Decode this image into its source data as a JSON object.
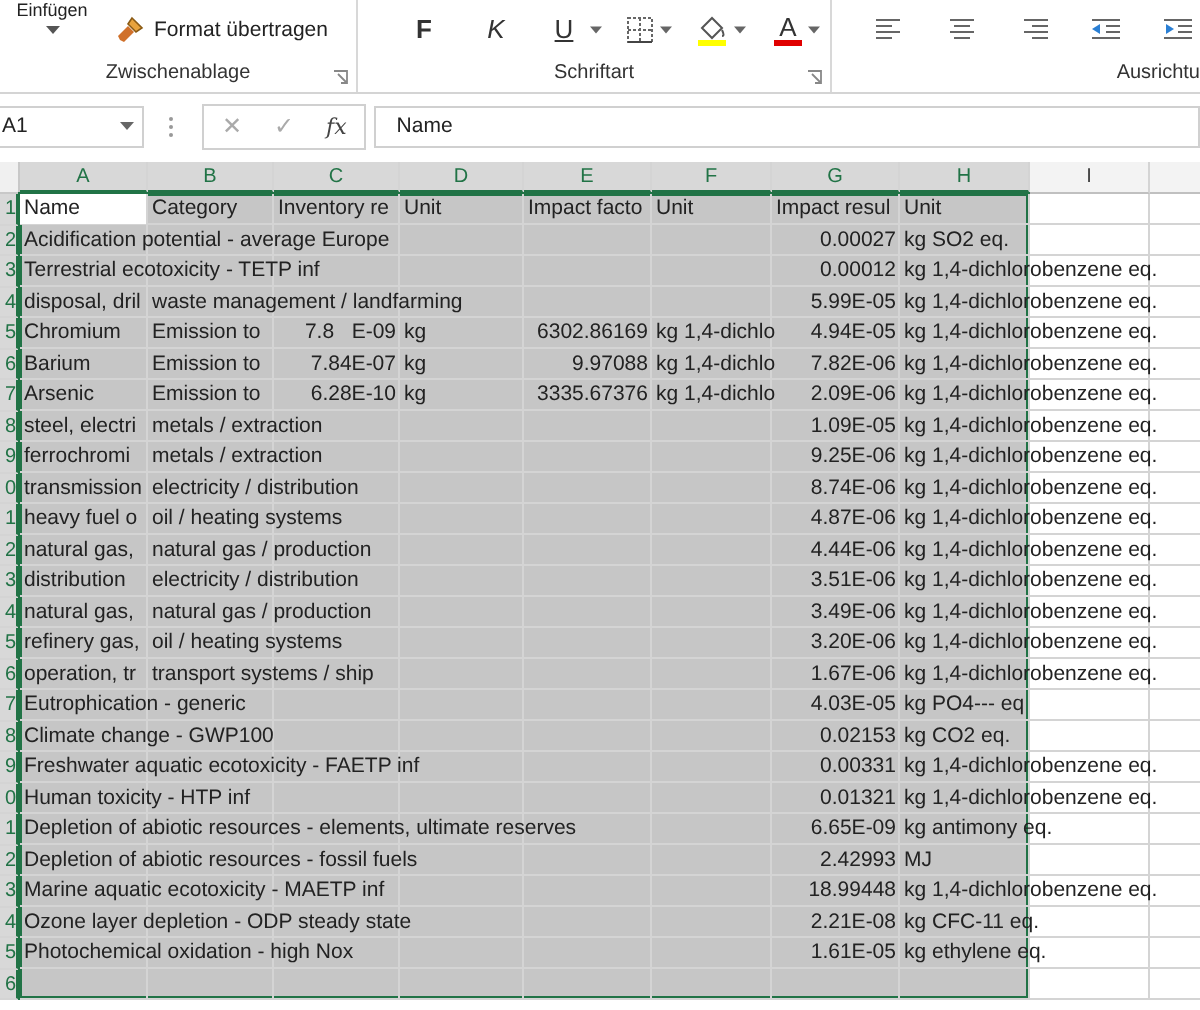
{
  "ribbon": {
    "paste_label": "Einfügen",
    "format_painter": "Format übertragen",
    "bold": "F",
    "italic": "K",
    "underline": "U",
    "font_color": "A",
    "groups": [
      {
        "label": "Zwischenablage",
        "launcher": true
      },
      {
        "label": "Schriftart",
        "launcher": true
      },
      {
        "label": "Ausrichtu",
        "launcher": false
      }
    ]
  },
  "formula_bar": {
    "name_box": "A1",
    "cancel": "✕",
    "enter": "✓",
    "function_label": "fx",
    "value": "Name"
  },
  "columns": [
    {
      "label": "A",
      "selected": true
    },
    {
      "label": "B",
      "selected": true
    },
    {
      "label": "C",
      "selected": true
    },
    {
      "label": "D",
      "selected": true
    },
    {
      "label": "E",
      "selected": true
    },
    {
      "label": "F",
      "selected": true
    },
    {
      "label": "G",
      "selected": true
    },
    {
      "label": "H",
      "selected": true
    },
    {
      "label": "I",
      "selected": false
    }
  ],
  "rows": [
    {
      "number": "1",
      "selected": true,
      "cells": [
        {
          "kind": "text",
          "text": "Name",
          "active": true
        },
        {
          "kind": "text",
          "text": "Category"
        },
        {
          "kind": "text",
          "text": "Inventory re"
        },
        {
          "kind": "text",
          "text": "Unit"
        },
        {
          "kind": "text",
          "text": "Impact facto"
        },
        {
          "kind": "text",
          "text": "Unit"
        },
        {
          "kind": "text",
          "text": "Impact resul"
        },
        {
          "kind": "text",
          "text": "Unit"
        }
      ]
    },
    {
      "number": "2",
      "selected": true,
      "cells": [
        {
          "kind": "text",
          "text": "Acidification potential - average Europe"
        },
        null,
        null,
        null,
        null,
        null,
        {
          "kind": "number",
          "text": "0.00027"
        },
        {
          "kind": "text",
          "text": "kg SO2 eq."
        }
      ]
    },
    {
      "number": "3",
      "selected": true,
      "cells": [
        {
          "kind": "text",
          "text": "Terrestrial ecotoxicity - TETP inf"
        },
        null,
        null,
        null,
        null,
        null,
        {
          "kind": "number",
          "text": "0.00012"
        },
        {
          "kind": "text",
          "text": "kg 1,4-dichlorobenzene eq."
        }
      ]
    },
    {
      "number": "4",
      "selected": true,
      "cells": [
        {
          "kind": "text",
          "text": "disposal, dril"
        },
        {
          "kind": "text",
          "text": "waste management / landfarming"
        },
        null,
        null,
        null,
        null,
        {
          "kind": "number",
          "text": "5.99E-05"
        },
        {
          "kind": "text",
          "text": "kg 1,4-dichlorobenzene eq."
        }
      ]
    },
    {
      "number": "5",
      "selected": true,
      "cells": [
        {
          "kind": "text",
          "text": "Chromium"
        },
        {
          "kind": "text",
          "text": "Emission to"
        },
        {
          "kind": "number",
          "text": "7.8   E-09"
        },
        {
          "kind": "text",
          "text": "kg"
        },
        {
          "kind": "number",
          "text": "6302.86169"
        },
        {
          "kind": "text",
          "text": "kg 1,4-dichlo"
        },
        {
          "kind": "number",
          "text": "4.94E-05"
        },
        {
          "kind": "text",
          "text": "kg 1,4-dichlorobenzene eq."
        }
      ]
    },
    {
      "number": "6",
      "selected": true,
      "cells": [
        {
          "kind": "text",
          "text": "Barium"
        },
        {
          "kind": "text",
          "text": "Emission to"
        },
        {
          "kind": "number",
          "text": "7.84E-07"
        },
        {
          "kind": "text",
          "text": "kg"
        },
        {
          "kind": "number",
          "text": "9.97088"
        },
        {
          "kind": "text",
          "text": "kg 1,4-dichlo"
        },
        {
          "kind": "number",
          "text": "7.82E-06"
        },
        {
          "kind": "text",
          "text": "kg 1,4-dichlorobenzene eq."
        }
      ]
    },
    {
      "number": "7",
      "selected": true,
      "cells": [
        {
          "kind": "text",
          "text": "Arsenic"
        },
        {
          "kind": "text",
          "text": "Emission to"
        },
        {
          "kind": "number",
          "text": "6.28E-10"
        },
        {
          "kind": "text",
          "text": "kg"
        },
        {
          "kind": "number",
          "text": "3335.67376"
        },
        {
          "kind": "text",
          "text": "kg 1,4-dichlo"
        },
        {
          "kind": "number",
          "text": "2.09E-06"
        },
        {
          "kind": "text",
          "text": "kg 1,4-dichlorobenzene eq."
        }
      ]
    },
    {
      "number": "8",
      "selected": true,
      "cells": [
        {
          "kind": "text",
          "text": "steel, electri"
        },
        {
          "kind": "text",
          "text": "metals / extraction"
        },
        null,
        null,
        null,
        null,
        {
          "kind": "number",
          "text": "1.09E-05"
        },
        {
          "kind": "text",
          "text": "kg 1,4-dichlorobenzene eq."
        }
      ]
    },
    {
      "number": "9",
      "selected": true,
      "cells": [
        {
          "kind": "text",
          "text": "ferrochromi"
        },
        {
          "kind": "text",
          "text": "metals / extraction"
        },
        null,
        null,
        null,
        null,
        {
          "kind": "number",
          "text": "9.25E-06"
        },
        {
          "kind": "text",
          "text": "kg 1,4-dichlorobenzene eq."
        }
      ]
    },
    {
      "number": "0",
      "selected": true,
      "cells": [
        {
          "kind": "text",
          "text": "transmission"
        },
        {
          "kind": "text",
          "text": "electricity / distribution"
        },
        null,
        null,
        null,
        null,
        {
          "kind": "number",
          "text": "8.74E-06"
        },
        {
          "kind": "text",
          "text": "kg 1,4-dichlorobenzene eq."
        }
      ]
    },
    {
      "number": "1",
      "selected": true,
      "cells": [
        {
          "kind": "text",
          "text": "heavy fuel o"
        },
        {
          "kind": "text",
          "text": "oil / heating systems"
        },
        null,
        null,
        null,
        null,
        {
          "kind": "number",
          "text": "4.87E-06"
        },
        {
          "kind": "text",
          "text": "kg 1,4-dichlorobenzene eq."
        }
      ]
    },
    {
      "number": "2",
      "selected": true,
      "cells": [
        {
          "kind": "text",
          "text": "natural gas,"
        },
        {
          "kind": "text",
          "text": "natural gas / production"
        },
        null,
        null,
        null,
        null,
        {
          "kind": "number",
          "text": "4.44E-06"
        },
        {
          "kind": "text",
          "text": "kg 1,4-dichlorobenzene eq."
        }
      ]
    },
    {
      "number": "3",
      "selected": true,
      "cells": [
        {
          "kind": "text",
          "text": "distribution"
        },
        {
          "kind": "text",
          "text": "electricity / distribution"
        },
        null,
        null,
        null,
        null,
        {
          "kind": "number",
          "text": "3.51E-06"
        },
        {
          "kind": "text",
          "text": "kg 1,4-dichlorobenzene eq."
        }
      ]
    },
    {
      "number": "4",
      "selected": true,
      "cells": [
        {
          "kind": "text",
          "text": "natural gas,"
        },
        {
          "kind": "text",
          "text": "natural gas / production"
        },
        null,
        null,
        null,
        null,
        {
          "kind": "number",
          "text": "3.49E-06"
        },
        {
          "kind": "text",
          "text": "kg 1,4-dichlorobenzene eq."
        }
      ]
    },
    {
      "number": "5",
      "selected": true,
      "cells": [
        {
          "kind": "text",
          "text": "refinery gas,"
        },
        {
          "kind": "text",
          "text": "oil / heating systems"
        },
        null,
        null,
        null,
        null,
        {
          "kind": "number",
          "text": "3.20E-06"
        },
        {
          "kind": "text",
          "text": "kg 1,4-dichlorobenzene eq."
        }
      ]
    },
    {
      "number": "6",
      "selected": true,
      "cells": [
        {
          "kind": "text",
          "text": "operation, tr"
        },
        {
          "kind": "text",
          "text": "transport systems / ship"
        },
        null,
        null,
        null,
        null,
        {
          "kind": "number",
          "text": "1.67E-06"
        },
        {
          "kind": "text",
          "text": "kg 1,4-dichlorobenzene eq."
        }
      ]
    },
    {
      "number": "7",
      "selected": true,
      "cells": [
        {
          "kind": "text",
          "text": "Eutrophication - generic"
        },
        null,
        null,
        null,
        null,
        null,
        {
          "kind": "number",
          "text": "4.03E-05"
        },
        {
          "kind": "text",
          "text": "kg PO4--- eq"
        }
      ]
    },
    {
      "number": "8",
      "selected": true,
      "cells": [
        {
          "kind": "text",
          "text": "Climate change - GWP100"
        },
        null,
        null,
        null,
        null,
        null,
        {
          "kind": "number",
          "text": "0.02153"
        },
        {
          "kind": "text",
          "text": "kg CO2 eq."
        }
      ]
    },
    {
      "number": "9",
      "selected": true,
      "cells": [
        {
          "kind": "text",
          "text": "Freshwater aquatic ecotoxicity - FAETP inf"
        },
        null,
        null,
        null,
        null,
        null,
        {
          "kind": "number",
          "text": "0.00331"
        },
        {
          "kind": "text",
          "text": "kg 1,4-dichlorobenzene eq."
        }
      ]
    },
    {
      "number": "0",
      "selected": true,
      "cells": [
        {
          "kind": "text",
          "text": "Human toxicity - HTP inf"
        },
        null,
        null,
        null,
        null,
        null,
        {
          "kind": "number",
          "text": "0.01321"
        },
        {
          "kind": "text",
          "text": "kg 1,4-dichlorobenzene eq."
        }
      ]
    },
    {
      "number": "1",
      "selected": true,
      "cells": [
        {
          "kind": "text",
          "text": "Depletion of abiotic resources - elements, ultimate reserves"
        },
        null,
        null,
        null,
        null,
        null,
        {
          "kind": "number",
          "text": "6.65E-09"
        },
        {
          "kind": "text",
          "text": "kg antimony eq."
        }
      ]
    },
    {
      "number": "2",
      "selected": true,
      "cells": [
        {
          "kind": "text",
          "text": "Depletion of abiotic resources - fossil fuels"
        },
        null,
        null,
        null,
        null,
        null,
        {
          "kind": "number",
          "text": "2.42993"
        },
        {
          "kind": "text",
          "text": "MJ"
        }
      ]
    },
    {
      "number": "3",
      "selected": true,
      "cells": [
        {
          "kind": "text",
          "text": "Marine aquatic ecotoxicity - MAETP inf"
        },
        null,
        null,
        null,
        null,
        null,
        {
          "kind": "number",
          "text": "18.99448"
        },
        {
          "kind": "text",
          "text": "kg 1,4-dichlorobenzene eq."
        }
      ]
    },
    {
      "number": "4",
      "selected": true,
      "cells": [
        {
          "kind": "text",
          "text": "Ozone layer depletion - ODP steady state"
        },
        null,
        null,
        null,
        null,
        null,
        {
          "kind": "number",
          "text": "2.21E-08"
        },
        {
          "kind": "text",
          "text": "kg CFC-11 eq."
        }
      ]
    },
    {
      "number": "5",
      "selected": true,
      "cells": [
        {
          "kind": "text",
          "text": "Photochemical oxidation - high Nox"
        },
        null,
        null,
        null,
        null,
        null,
        {
          "kind": "number",
          "text": "1.61E-05"
        },
        {
          "kind": "text",
          "text": "kg ethylene eq."
        }
      ]
    },
    {
      "number": "6",
      "selected": true,
      "cells": []
    }
  ]
}
